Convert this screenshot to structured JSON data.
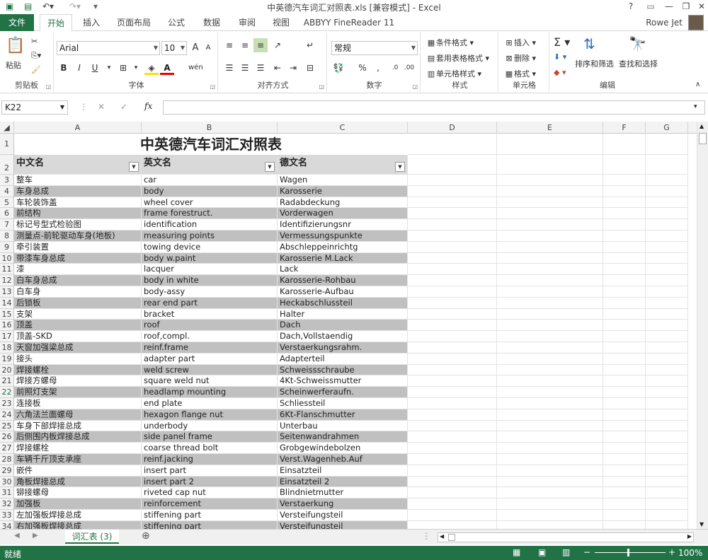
{
  "window": {
    "title": "中英德汽车词汇对照表.xls  [兼容模式] - Excel",
    "minimize": "—",
    "restore": "❐",
    "close": "✕",
    "help": "?"
  },
  "ribbon_tabs": {
    "file": "文件",
    "home": "开始",
    "insert": "插入",
    "page_layout": "页面布局",
    "formulas": "公式",
    "data": "数据",
    "review": "审阅",
    "view": "视图",
    "abbyy": "ABBYY FineReader 11"
  },
  "user": "Rowe Jet",
  "ribbon": {
    "clipboard": {
      "label": "剪贴板",
      "paste": "粘贴"
    },
    "font": {
      "label": "字体",
      "name": "Arial",
      "size": "10",
      "bold": "B",
      "italic": "I",
      "underline": "U",
      "grow": "A",
      "shrink": "A"
    },
    "alignment": {
      "label": "对齐方式"
    },
    "number": {
      "label": "数字",
      "format": "常规"
    },
    "styles": {
      "label": "样式",
      "conditional": "条件格式",
      "table": "套用表格格式",
      "cell": "单元格样式"
    },
    "cells": {
      "label": "单元格",
      "insert": "插入",
      "delete": "删除",
      "format": "格式"
    },
    "editing": {
      "label": "编辑",
      "sort": "排序和筛选",
      "find": "查找和选择"
    }
  },
  "formula_bar": {
    "name_box": "K22",
    "cancel": "✕",
    "enter": "✓",
    "fx": "fx",
    "value": ""
  },
  "columns": [
    "A",
    "B",
    "C",
    "D",
    "E",
    "F",
    "G"
  ],
  "sheet_title": "中英德汽车词汇对照表",
  "headers": [
    "中文名",
    "英文名",
    "德文名"
  ],
  "rows": [
    {
      "n": "3",
      "cn": "整车",
      "en": "car",
      "de": "Wagen"
    },
    {
      "n": "4",
      "cn": "车身总成",
      "en": "body",
      "de": "Karosserie"
    },
    {
      "n": "5",
      "cn": "车轮装饰盖",
      "en": "wheel cover",
      "de": "Radabdeckung"
    },
    {
      "n": "6",
      "cn": "前结构",
      "en": "frame forestruct.",
      "de": "Vorderwagen"
    },
    {
      "n": "7",
      "cn": "标记号型式检验图",
      "en": "identification",
      "de": "Identifizierungsnr"
    },
    {
      "n": "8",
      "cn": "测量点-前轮驱动车身(地板)",
      "en": "measuring points",
      "de": "Vermessungspunkte"
    },
    {
      "n": "9",
      "cn": "牵引装置",
      "en": "towing device",
      "de": "Abschleppeinrichtg"
    },
    {
      "n": "10",
      "cn": "带漆车身总成",
      "en": "body w.paint",
      "de": "Karosserie M.Lack"
    },
    {
      "n": "11",
      "cn": "漆",
      "en": "lacquer",
      "de": "Lack"
    },
    {
      "n": "12",
      "cn": "白车身总成",
      "en": "body in white",
      "de": "Karosserie-Rohbau"
    },
    {
      "n": "13",
      "cn": "白车身",
      "en": "body-assy",
      "de": "Karosserie-Aufbau"
    },
    {
      "n": "14",
      "cn": "后锁板",
      "en": "rear end part",
      "de": "Heckabschlussteil"
    },
    {
      "n": "15",
      "cn": "支架",
      "en": "bracket",
      "de": "Halter"
    },
    {
      "n": "16",
      "cn": "顶盖",
      "en": "roof",
      "de": "Dach"
    },
    {
      "n": "17",
      "cn": "顶盖-SKD",
      "en": "roof,compl.",
      "de": "Dach,Vollstaendig"
    },
    {
      "n": "18",
      "cn": "天窗加强梁总成",
      "en": "reinf.frame",
      "de": "Verstaerkungsrahm."
    },
    {
      "n": "19",
      "cn": "接头",
      "en": "adapter part",
      "de": "Adapterteil"
    },
    {
      "n": "20",
      "cn": "焊接螺栓",
      "en": "weld screw",
      "de": "Schweissschraube"
    },
    {
      "n": "21",
      "cn": "焊接方螺母",
      "en": "square weld nut",
      "de": "4Kt-Schweissmutter"
    },
    {
      "n": "22",
      "cn": "前照灯支架",
      "en": "headlamp mounting",
      "de": "Scheinwerferaufn."
    },
    {
      "n": "23",
      "cn": "连接板",
      "en": "end plate",
      "de": "Schliessteil"
    },
    {
      "n": "24",
      "cn": "六角法兰面螺母",
      "en": "hexagon flange nut",
      "de": "6Kt-Flanschmutter"
    },
    {
      "n": "25",
      "cn": "车身下部焊接总成",
      "en": "underbody",
      "de": "Unterbau"
    },
    {
      "n": "26",
      "cn": "后侧围内板焊接总成",
      "en": "side panel frame",
      "de": "Seitenwandrahmen"
    },
    {
      "n": "27",
      "cn": "焊接螺栓",
      "en": "coarse thread bolt",
      "de": "Grobgewindebolzen"
    },
    {
      "n": "28",
      "cn": "车辆千斤顶支承座",
      "en": "reinf.jacking",
      "de": "Verst.Wagenheb.Auf"
    },
    {
      "n": "29",
      "cn": "嵌件",
      "en": "insert part",
      "de": "Einsatzteil"
    },
    {
      "n": "30",
      "cn": "角板焊接总成",
      "en": "insert part 2",
      "de": "Einsatzteil 2"
    },
    {
      "n": "31",
      "cn": "铆接螺母",
      "en": "riveted cap nut",
      "de": "Blindnietmutter"
    },
    {
      "n": "32",
      "cn": "加强板",
      "en": "reinforcement",
      "de": "Verstaerkung"
    },
    {
      "n": "33",
      "cn": "左加强板焊接总成",
      "en": "stiffening part",
      "de": "Versteifungsteil"
    },
    {
      "n": "34",
      "cn": "右加强板焊接总成",
      "en": "stiffening part",
      "de": "Versteifungsteil"
    }
  ],
  "sheet_tab": "词汇表 (3)",
  "status": {
    "ready": "就绪",
    "zoom": "100%"
  },
  "colors": {
    "accent": "#217346",
    "band": "#c0c0c0",
    "header": "#d9d9d9"
  }
}
